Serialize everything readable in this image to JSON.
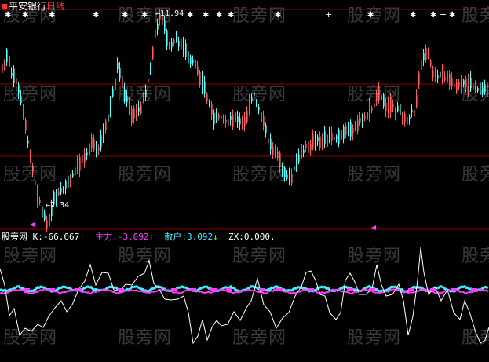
{
  "window": {
    "stock_name": "平安银行",
    "period": "日线",
    "indicator_prefix": "股旁网"
  },
  "price_chart": {
    "high_annotation": "11.94",
    "low_annotation": "7.34"
  },
  "indicator": {
    "k_label": "K:",
    "k_value": "-66.667",
    "k_arrow": "↑",
    "main_label": "主力:",
    "main_value": "-3.092",
    "main_arrow": "↑",
    "retail_label": "散户:",
    "retail_value": "3.092",
    "retail_arrow": "↓",
    "zx_label": "ZX:",
    "zx_value": "0.000,"
  },
  "watermark": "股旁网",
  "colors": {
    "background": "#000000",
    "grid": "#8b0000",
    "candle_up": "#ff5a5a",
    "candle_down": "#54ffff",
    "k_line": "#ffffff",
    "main_line": "#ff3cff",
    "retail_line": "#3cf0ff",
    "marker": "#ff3cff"
  },
  "icons": [
    "star-marker",
    "cross-marker",
    "triangle-marker"
  ]
}
